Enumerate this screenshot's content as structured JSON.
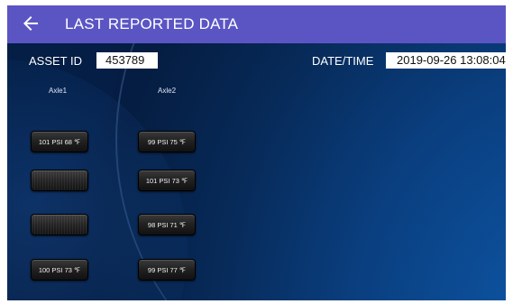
{
  "appbar": {
    "title": "LAST REPORTED DATA",
    "back_icon": "arrow-left-icon",
    "color": "#5b55c4"
  },
  "asset": {
    "label": "ASSET ID",
    "value": "453789"
  },
  "datetime": {
    "label": "DATE/TIME",
    "value": "2019-09-26 13:08:04"
  },
  "axles": [
    {
      "name": "Axle1",
      "tires": [
        "101 PSI 68 ℉",
        "",
        "",
        "100 PSI 73 ℉"
      ]
    },
    {
      "name": "Axle2",
      "tires": [
        "99 PSI 75 ℉",
        "101 PSI 73 ℉",
        "98 PSI 71 ℉",
        "99 PSI 77 ℉"
      ]
    }
  ]
}
